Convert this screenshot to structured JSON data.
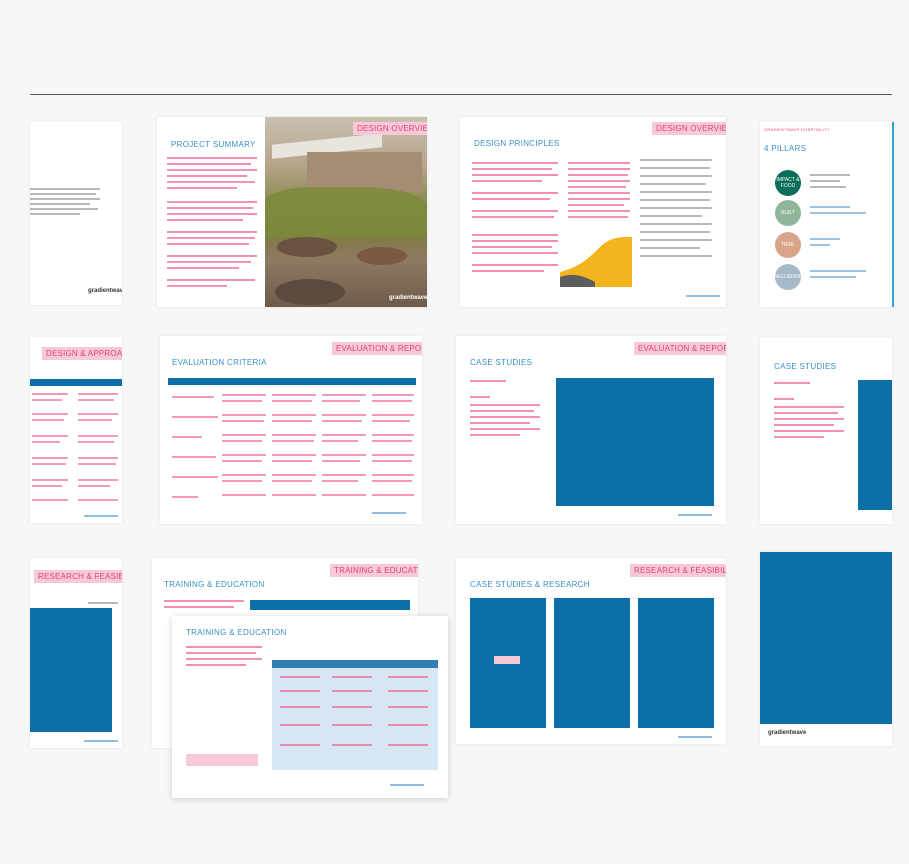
{
  "pages": {
    "p_intro_cover": {
      "title": "",
      "logo": "gradientwave"
    },
    "p_project_summary": {
      "title": "PROJECT SUMMARY",
      "tag": "DESIGN OVERVIEW",
      "logo": "gradientwave"
    },
    "p_design_overview": {
      "title": "DESIGN PRINCIPLES",
      "tag": "DESIGN OVERVIEW"
    },
    "p_pillars": {
      "title": "4 PILLARS",
      "kicker": "GRADIENTWAVE HOSPITALITY",
      "circles": [
        "IMPACT & FOOD",
        "BUILT",
        "TRAIL",
        "WELLBEING"
      ]
    },
    "p_table_left": {
      "tag": "DESIGN & APPROACH"
    },
    "p_evaluation": {
      "title": "EVALUATION CRITERIA",
      "tag": "EVALUATION & REPORTING"
    },
    "p_case_studies": {
      "title": "CASE STUDIES",
      "tag": "EVALUATION & REPORTING"
    },
    "p_case_studies_right": {
      "title": "CASE STUDIES"
    },
    "p_research_left": {
      "tag": "RESEARCH & FEASIBILITY"
    },
    "p_training_back": {
      "title": "TRAINING & EDUCATION",
      "tag": "TRAINING & EDUCATION"
    },
    "p_training_front": {
      "title": "TRAINING & EDUCATION"
    },
    "p_case_studies_research": {
      "title": "CASE STUDIES & RESEARCH",
      "tag": "RESEARCH & FEASIBILITY"
    },
    "p_end": {
      "logo": "gradientwave"
    }
  },
  "colors": {
    "accent_pink": "#e5407c",
    "tag_bg": "#f6c9d6",
    "title_blue": "#3a8fc4",
    "block_blue": "#0d6fa8"
  }
}
